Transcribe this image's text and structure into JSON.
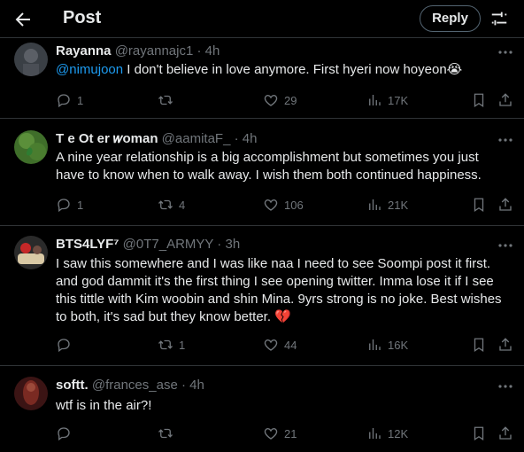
{
  "header": {
    "title": "Post",
    "reply_label": "Reply"
  },
  "tweets": [
    {
      "name": "Rayanna",
      "handle": "@rayannajc1 · 4h",
      "mention": "@nimujoon",
      "text": " I don't believe in love anymore. First hyeri now hoyeon😭",
      "replies": "1",
      "retweets": "",
      "likes": "29",
      "views": "17K"
    },
    {
      "name": "T  e Ot  er 𝑤oman",
      "handle": "@aamitaF_ · 4h",
      "text": "A nine year relationship is a big accomplishment but sometimes you just have to know when to walk away. I wish them both continued happiness.",
      "replies": "1",
      "retweets": "4",
      "likes": "106",
      "views": "21K"
    },
    {
      "name": "BTS4LYF⁷",
      "handle": "@0T7_ARMYY · 3h",
      "text": "I saw this somewhere and I was like naa I need to see Soompi post it first. and  god dammit it's the first thing I see opening twitter. Imma lose it if I see this tittle with Kim woobin and shin Mina. 9yrs strong is no joke. Best wishes to both, it's sad but they know better. 💔",
      "replies": "",
      "retweets": "1",
      "likes": "44",
      "views": "16K"
    },
    {
      "name": "softt.",
      "handle": "@frances_ase · 4h",
      "text": "wtf is in the air?!",
      "replies": "",
      "retweets": "",
      "likes": "21",
      "views": "12K"
    }
  ],
  "colors": {
    "background": "#000000",
    "text": "#e7e9ea",
    "muted": "#71767b",
    "link": "#1d9bf0",
    "divider": "#2f3336",
    "broken_heart": "#f91880"
  }
}
